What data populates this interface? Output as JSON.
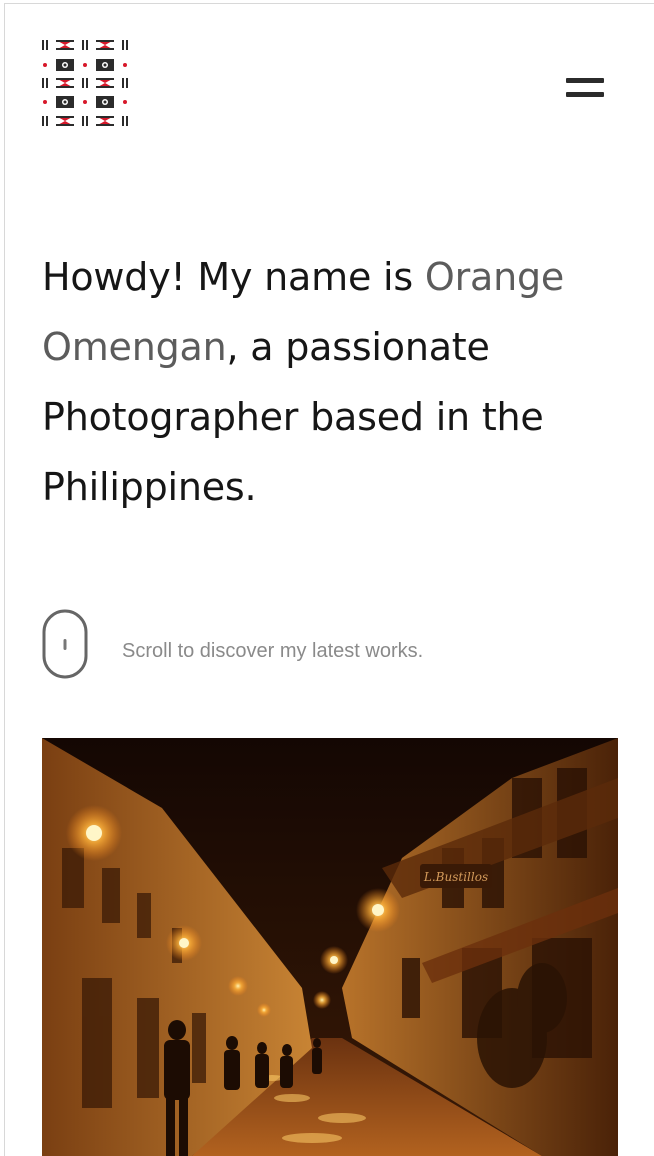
{
  "header": {
    "logo_icon": "woven-pattern-logo-icon",
    "menu_icon": "hamburger-menu-icon"
  },
  "intro": {
    "prefix": "Howdy! My name is ",
    "name": "Orange Omengan",
    "suffix": ", a passionate Photographer based in the Philippines."
  },
  "scroll_hint": {
    "icon": "mouse-scroll-icon",
    "text": "Scroll to discover my latest works."
  },
  "featured_photo": {
    "sign_text": "L.Bustillos"
  },
  "colors": {
    "logo_red": "#d7182a",
    "logo_dark": "#2b2b2b",
    "name_accent": "#5c5c5c",
    "text": "#161616",
    "muted": "#8a8a8a"
  }
}
